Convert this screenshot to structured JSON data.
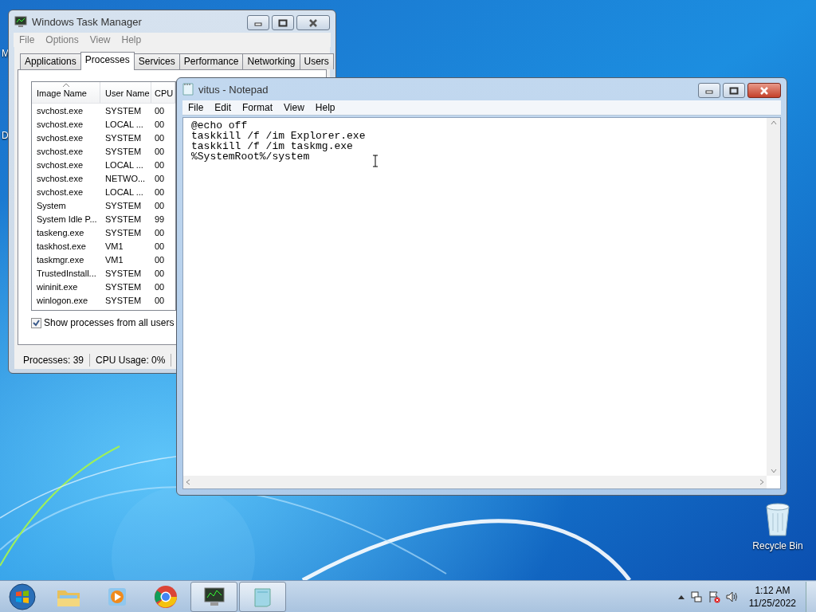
{
  "desktop": {
    "edge_labels": [
      "M",
      "D"
    ],
    "icons": [
      {
        "label": "Recycle Bin"
      }
    ]
  },
  "task_manager": {
    "title": "Windows Task Manager",
    "menu": [
      "File",
      "Options",
      "View",
      "Help"
    ],
    "tabs": [
      {
        "label": "Applications",
        "selected": false
      },
      {
        "label": "Processes",
        "selected": true
      },
      {
        "label": "Services",
        "selected": false
      },
      {
        "label": "Performance",
        "selected": false
      },
      {
        "label": "Networking",
        "selected": false
      },
      {
        "label": "Users",
        "selected": false
      }
    ],
    "columns": [
      {
        "label": "Image Name",
        "sorted": true
      },
      {
        "label": "User Name",
        "sorted": false
      },
      {
        "label": "CPU",
        "sorted": false
      }
    ],
    "rows": [
      {
        "image_name": "svchost.exe",
        "user_name": "SYSTEM",
        "cpu": "00"
      },
      {
        "image_name": "svchost.exe",
        "user_name": "LOCAL ...",
        "cpu": "00"
      },
      {
        "image_name": "svchost.exe",
        "user_name": "SYSTEM",
        "cpu": "00"
      },
      {
        "image_name": "svchost.exe",
        "user_name": "SYSTEM",
        "cpu": "00"
      },
      {
        "image_name": "svchost.exe",
        "user_name": "LOCAL ...",
        "cpu": "00"
      },
      {
        "image_name": "svchost.exe",
        "user_name": "NETWO...",
        "cpu": "00"
      },
      {
        "image_name": "svchost.exe",
        "user_name": "LOCAL ...",
        "cpu": "00"
      },
      {
        "image_name": "System",
        "user_name": "SYSTEM",
        "cpu": "00"
      },
      {
        "image_name": "System Idle P...",
        "user_name": "SYSTEM",
        "cpu": "99"
      },
      {
        "image_name": "taskeng.exe",
        "user_name": "SYSTEM",
        "cpu": "00"
      },
      {
        "image_name": "taskhost.exe",
        "user_name": "VM1",
        "cpu": "00"
      },
      {
        "image_name": "taskmgr.exe",
        "user_name": "VM1",
        "cpu": "00"
      },
      {
        "image_name": "TrustedInstall...",
        "user_name": "SYSTEM",
        "cpu": "00"
      },
      {
        "image_name": "wininit.exe",
        "user_name": "SYSTEM",
        "cpu": "00"
      },
      {
        "image_name": "winlogon.exe",
        "user_name": "SYSTEM",
        "cpu": "00"
      }
    ],
    "show_all_users": {
      "label": "Show processes from all users",
      "checked": true
    },
    "status_bar": [
      "Processes: 39",
      "CPU Usage: 0%"
    ]
  },
  "notepad": {
    "title": "vitus - Notepad",
    "menu": [
      "File",
      "Edit",
      "Format",
      "View",
      "Help"
    ],
    "lines": [
      "@echo off",
      "taskkill /f /im Explorer.exe",
      "taskkill /f /im taskmg.exe",
      "%SystemRoot%/system"
    ]
  },
  "taskbar": {
    "apps": [
      {
        "kind": "explorer",
        "running": false
      },
      {
        "kind": "media",
        "running": false
      },
      {
        "kind": "browser",
        "running": false
      },
      {
        "kind": "taskmgr",
        "running": true
      },
      {
        "kind": "notepad",
        "running": true
      }
    ],
    "clock": {
      "time": "1:12 AM",
      "date": "11/25/2022"
    }
  }
}
